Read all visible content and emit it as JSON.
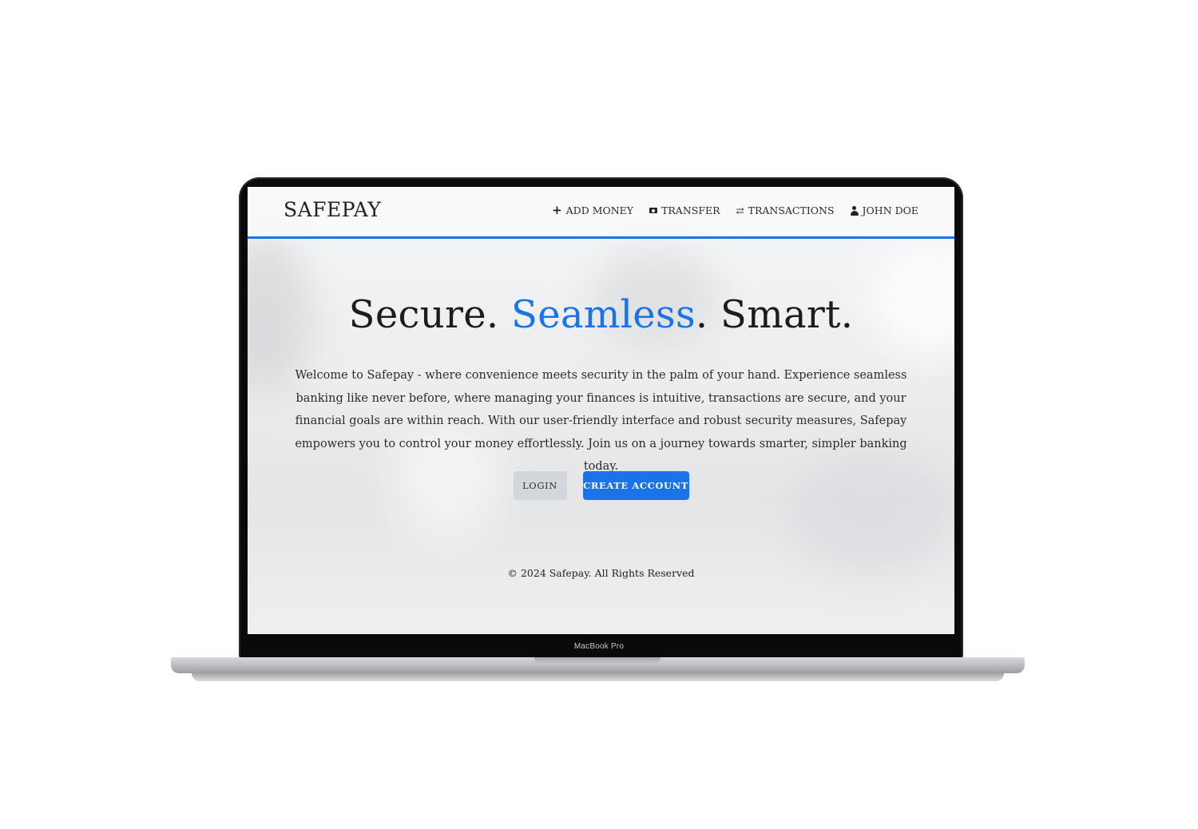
{
  "device": {
    "bezel_label": "MacBook Pro"
  },
  "navbar": {
    "brand": "SAFEPAY",
    "links": [
      {
        "icon": "plus-icon",
        "label": "ADD MONEY"
      },
      {
        "icon": "money-bill-icon",
        "label": "TRANSFER"
      },
      {
        "icon": "exchange-arrows-icon",
        "label": "TRANSACTIONS"
      },
      {
        "icon": "user-icon",
        "label": "JOHN DOE"
      }
    ]
  },
  "hero": {
    "title_part1": "Secure. ",
    "title_accent": "Seamless",
    "title_part2": ". Smart.",
    "description": "Welcome to Safepay - where convenience meets security in the palm of your hand. Experience seamless banking like never before, where managing your finances is intuitive, transactions are secure, and your financial goals are within reach. With our user-friendly interface and robust security measures, Safepay empowers you to control your money effortlessly. Join us on a journey towards smarter, simpler banking today."
  },
  "actions": {
    "login_label": "LOGIN",
    "create_account_label": "CREATE ACCOUNT"
  },
  "footer": {
    "text": "© 2024 Safepay. All Rights Reserved"
  },
  "colors": {
    "accent": "#1a73e8",
    "secondary_button": "#d3d6da",
    "text": "#222222"
  }
}
